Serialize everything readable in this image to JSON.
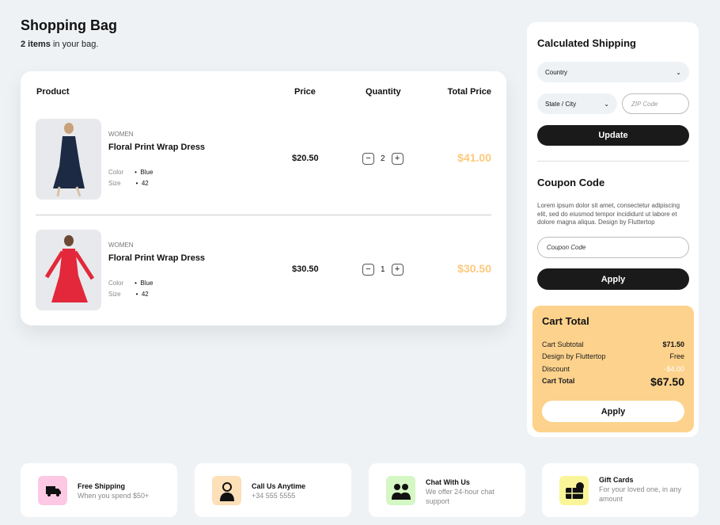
{
  "header": {
    "title": "Shopping Bag",
    "count": "2 items",
    "count_suffix": " in your bag."
  },
  "table": {
    "headers": [
      "Product",
      "Price",
      "Quantity",
      "Total Price"
    ],
    "rows": [
      {
        "category": "WOMEN",
        "name": "Floral Print Wrap Dress",
        "color_label": "Color",
        "color": "Blue",
        "size_label": "Size",
        "size": "42",
        "price": "$20.50",
        "quantity": "2",
        "total": "$41.00"
      },
      {
        "category": "WOMEN",
        "name": "Floral Print Wrap Dress",
        "color_label": "Color",
        "color": "Blue",
        "size_label": "Size",
        "size": "42",
        "price": "$30.50",
        "quantity": "1",
        "total": "$30.50"
      }
    ]
  },
  "shipping": {
    "title": "Calculated Shipping",
    "country": "Country",
    "state": "State / City",
    "zip_placeholder": "ZIP Code",
    "update": "Update"
  },
  "coupon": {
    "title": "Coupon Code",
    "text": "Lorem ipsum dolor sit amet, consectetur adipiscing elit, sed do eiusmod tempor incididunt ut labore et dolore magna aliqua. Design by Fluttertop",
    "placeholder": "Coupon Code",
    "apply": "Apply"
  },
  "cart_total": {
    "title": "Cart Total",
    "subtotal_label": "Cart Subtotal",
    "subtotal": "$71.50",
    "design_label": "Design by Fluttertop",
    "design": "Free",
    "discount_label": "Discount",
    "discount": "-$4.00",
    "total_label": "Cart Total",
    "total": "$67.50",
    "apply": "Apply"
  },
  "features": [
    {
      "title": "Free Shipping",
      "text": "When you spend $50+",
      "color": "#fdc8e4"
    },
    {
      "title": "Call Us Anytime",
      "text": "+34 555 5555",
      "color": "#fddfb8"
    },
    {
      "title": "Chat With Us",
      "text": "We offer 24-hour chat support",
      "color": "#d4f7c4"
    },
    {
      "title": "Gift Cards",
      "text": "For your loved one, in any amount",
      "color": "#fbf59a"
    }
  ]
}
